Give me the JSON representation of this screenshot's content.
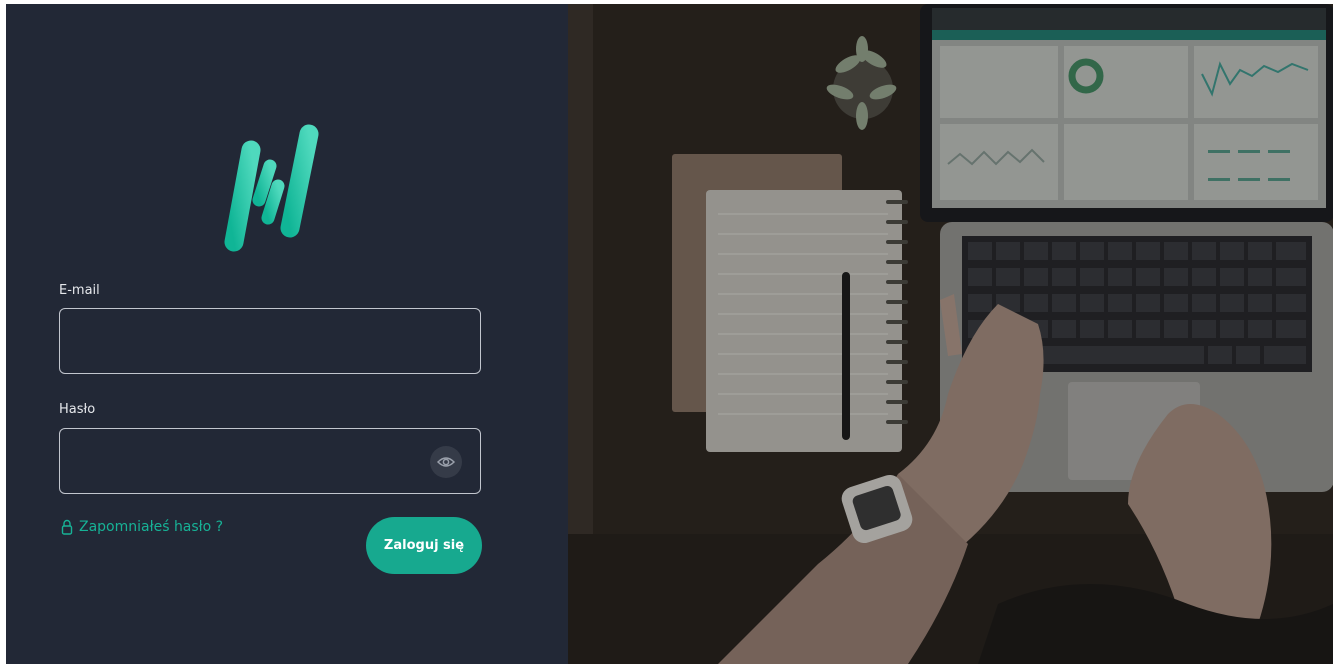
{
  "login_form": {
    "email_label": "E-mail",
    "email_value": "",
    "password_label": "Hasło",
    "password_value": "",
    "forgot_password_label": "Zapomniałeś hasło ?",
    "submit_label": "Zaloguj się"
  },
  "colors": {
    "panel_background": "#222836",
    "accent": "#17b296",
    "button": "#17a98f"
  },
  "icons": {
    "logo": "brand-logo-icon",
    "password_visibility": "eye-icon",
    "forgot_password": "lock-icon"
  }
}
